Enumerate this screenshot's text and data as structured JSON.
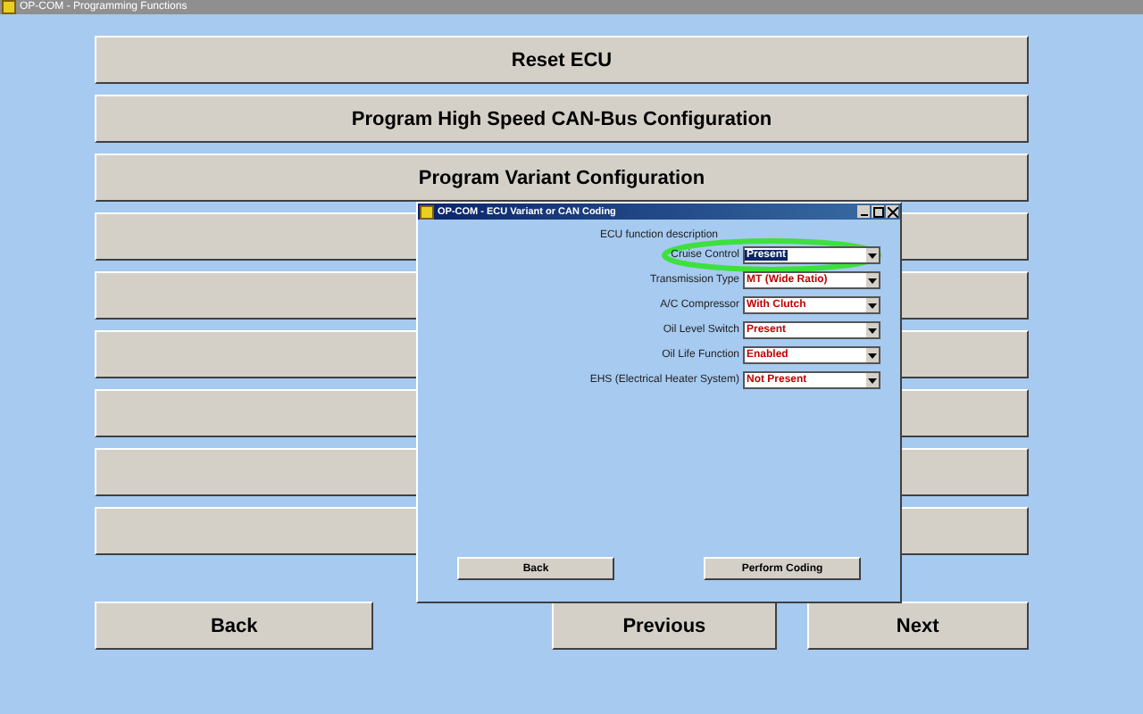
{
  "window": {
    "title": "OP-COM - Programming Functions"
  },
  "menu_buttons": [
    {
      "kind": "labeled",
      "label": "Reset ECU"
    },
    {
      "kind": "labeled",
      "label": "Program High Speed CAN-Bus Configuration"
    },
    {
      "kind": "labeled",
      "label": "Program Variant Configuration"
    },
    {
      "kind": "blank"
    },
    {
      "kind": "blank"
    },
    {
      "kind": "blank"
    },
    {
      "kind": "blank"
    },
    {
      "kind": "blank"
    },
    {
      "kind": "blank"
    }
  ],
  "nav_buttons": [
    {
      "label": "Back"
    },
    {
      "label": "Previous"
    },
    {
      "label": "Next"
    }
  ],
  "dialog": {
    "title": "OP-COM - ECU Variant or CAN Coding",
    "heading": "ECU function description",
    "rows": [
      {
        "label": "Cruise Control",
        "value": "Present",
        "selected": true,
        "circled": true
      },
      {
        "label": "Transmission Type",
        "value": "MT (Wide Ratio)",
        "selected": false,
        "circled": false
      },
      {
        "label": "A/C Compressor",
        "value": "With Clutch",
        "selected": false,
        "circled": false
      },
      {
        "label": "Oil Level Switch",
        "value": "Present",
        "selected": false,
        "circled": false
      },
      {
        "label": "Oil Life Function",
        "value": "Enabled",
        "selected": false,
        "circled": false
      },
      {
        "label": "EHS (Electrical Heater System)",
        "value": "Not Present",
        "selected": false,
        "circled": false
      }
    ],
    "buttons": [
      "Back",
      "Perform Coding"
    ]
  }
}
